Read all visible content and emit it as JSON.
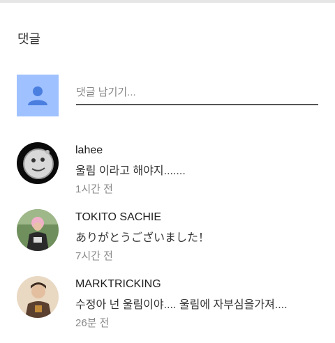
{
  "header": {
    "title": "댓글"
  },
  "composer": {
    "placeholder": "댓글 남기기..."
  },
  "comments": [
    {
      "author": "lahee",
      "text": "울림 이라고 해야지.......",
      "time": "1시간 전"
    },
    {
      "author": "TOKITO SACHIE",
      "text": "ありがとうございました！",
      "time": "7시간 전"
    },
    {
      "author": "MARKTRICKING",
      "text": "수정아 넌 울림이야.... 울림에 자부심을가져....",
      "time": "26분 전"
    }
  ],
  "colors": {
    "self_avatar_bg": "#a0c1ff",
    "self_avatar_icon": "#4a7fe0"
  }
}
